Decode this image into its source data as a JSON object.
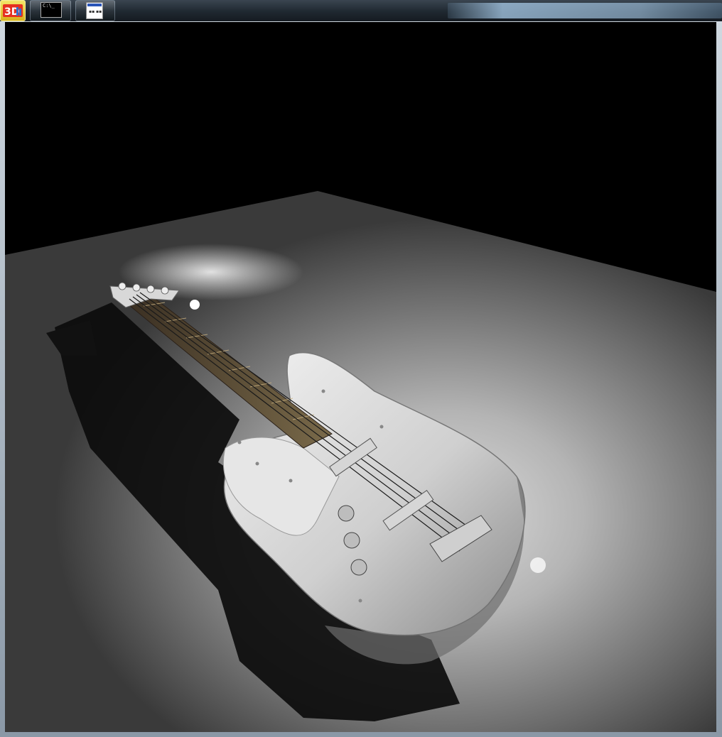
{
  "taskbar": {
    "items": [
      {
        "name": "3d-app",
        "label": "3D"
      },
      {
        "name": "command-prompt",
        "label": "C:\\_"
      },
      {
        "name": "window-app",
        "label": ""
      }
    ]
  },
  "scene": {
    "subject": "bass-guitar",
    "background": "#000000",
    "floor_light": "#c8c8c8"
  }
}
